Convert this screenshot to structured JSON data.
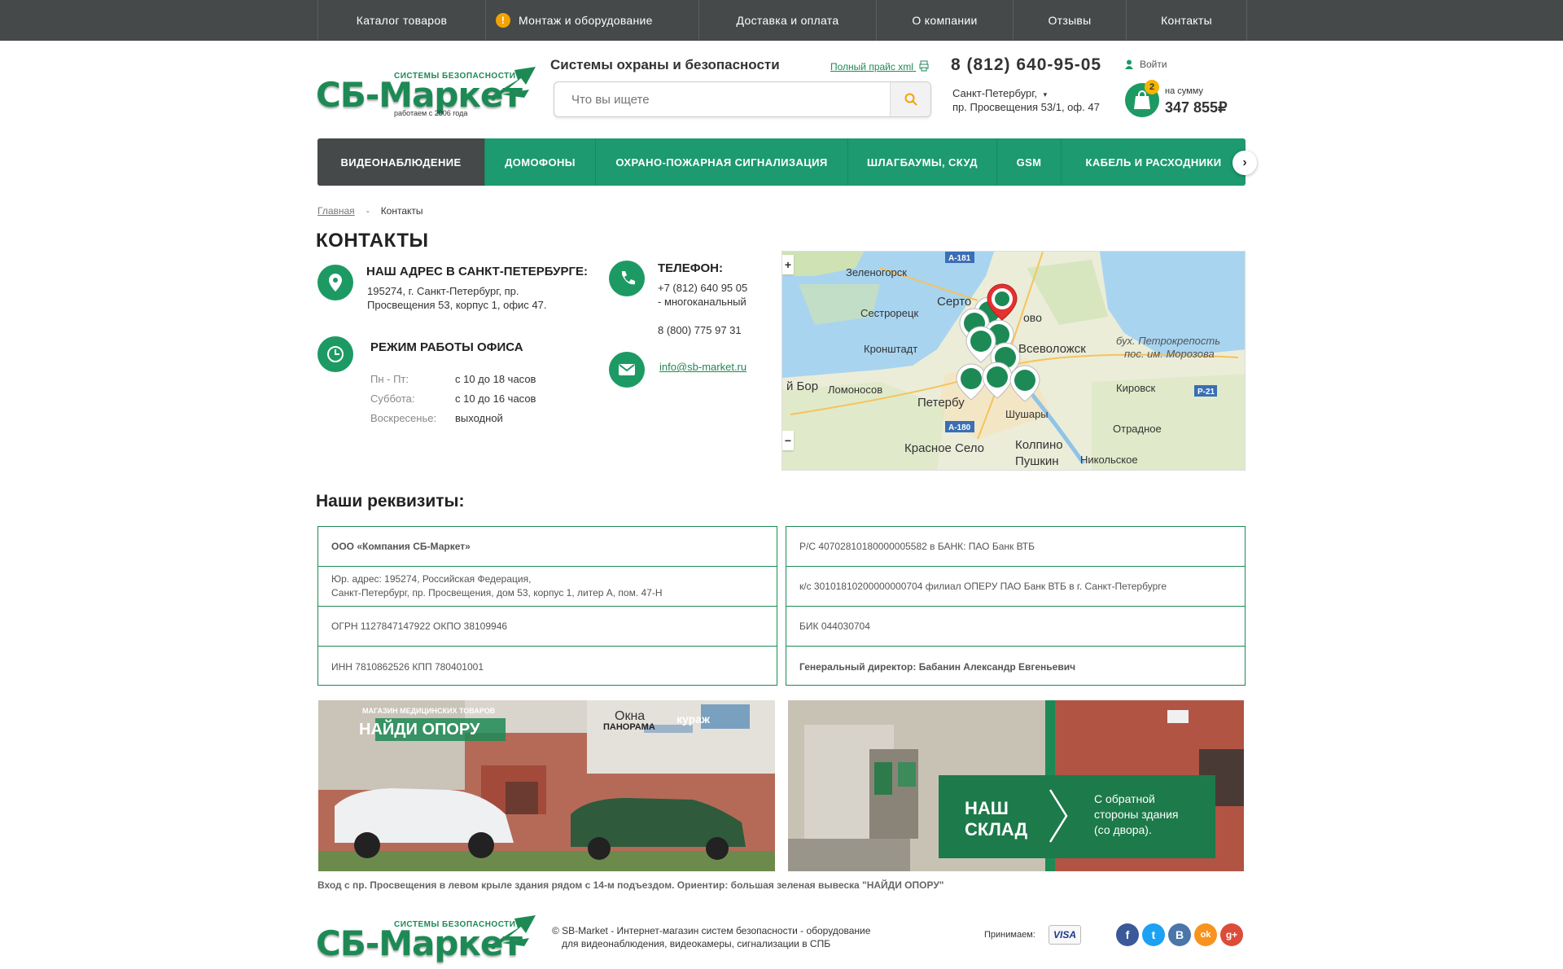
{
  "topnav": {
    "items": [
      "Каталог товаров",
      "Монтаж и оборудование",
      "Доставка и оплата",
      "О компании",
      "Отзывы",
      "Контакты"
    ],
    "warn_symbol": "!"
  },
  "header": {
    "logo_top": "СИСТЕМЫ БЕЗОПАСНОСТИ",
    "logo_text": "СБ-Маркет",
    "logo_sub": "работаем с 2006 года",
    "tagline": "Системы охраны и безопасности",
    "price_link": "Полный прайс xml",
    "search_placeholder": "Что вы ищете",
    "phone": "8 (812) 640-95-05",
    "city": "Санкт-Петербург,",
    "address": "пр. Просвещения 53/1, оф. 47",
    "login": "Войти",
    "cart_count": "2",
    "cart_label": "на сумму",
    "cart_sum": "347 855₽"
  },
  "catnav": {
    "items": [
      "ВИДЕОНАБЛЮДЕНИЕ",
      "ДОМОФОНЫ",
      "ОХРАНО-ПОЖАРНАЯ СИГНАЛИЗАЦИЯ",
      "ШЛАГБАУМЫ, СКУД",
      "GSM",
      "КАБЕЛЬ И РАСХОДНИКИ"
    ],
    "next": "›"
  },
  "breadcrumb": {
    "home": "Главная",
    "sep": "-",
    "current": "Контакты"
  },
  "page_title": "КОНТАКТЫ",
  "contacts": {
    "address_title": "НАШ АДРЕС В САНКТ-ПЕТЕРБУРГЕ:",
    "address_line1": "195274, г. Санкт-Петербург, пр.",
    "address_line2": "Просвещения 53, корпус 1, офис 47.",
    "hours_title": "РЕЖИМ РАБОТЫ ОФИСА",
    "hours": [
      {
        "label": "Пн - Пт:",
        "value": "с 10 до 18 часов"
      },
      {
        "label": "Суббота:",
        "value": "с 10 до 16 часов"
      },
      {
        "label": "Воскресенье:",
        "value": "выходной"
      }
    ],
    "phone_title": "ТЕЛЕФОН:",
    "phone1": "+7 (812) 640 95 05",
    "phone1_note": "- многоканальный",
    "phone2": "8 (800) 775 97 31",
    "email": "info@sb-market.ru"
  },
  "map": {
    "labels": [
      "Зеленогорск",
      "Сестрорецк",
      "Серто",
      "ово",
      "Кронштадт",
      "Всеволожск",
      "бух. Петрокрепость",
      "пос. им. Морозова",
      "й Бор",
      "Ломоносов",
      "Петербу",
      "Шушары",
      "Кировск",
      "Отрадное",
      "Красное Село",
      "Колпино",
      "Пушкин",
      "Никольское"
    ],
    "road_labels": [
      "А-181",
      "А-180",
      "Р-21"
    ],
    "zoom_in": "+",
    "zoom_out": "−"
  },
  "requisites": {
    "title": "Наши реквизиты:",
    "left": [
      "ООО «Компания СБ-Маркет»",
      "Юр. адрес: 195274, Российская Федерация,",
      "Санкт-Петербург, пр. Просвещения, дом 53, корпус 1, литер А, пом. 47-Н",
      "ОГРН 1127847147922 ОКПО 38109946",
      "ИНН 7810862526 КПП 780401001"
    ],
    "right": [
      "Р/С 40702810180000005582 в БАНК: ПАО Банк ВТБ",
      "к/с 30101810200000000704 филиал ОПЕРУ ПАО Банк ВТБ в г. Санкт-Петербурге",
      "БИК 044030704",
      "Генеральный директор: Бабанин Александр Евгеньевич"
    ]
  },
  "photos": {
    "sign1": "МАГАЗИН МЕДИЦИНСКИХ ТОВАРОВ",
    "sign2": "НАЙДИ ОПОРУ",
    "sign3": "Окна",
    "sign4": "ПАНОРАМА",
    "sign5": "кураж",
    "warehouse_title1": "НАШ",
    "warehouse_title2": "СКЛАД",
    "warehouse_note": "С обратной стороны здания (со двора).",
    "caption": "Вход с пр. Просвещения в левом крыле здания рядом с 14-м подъездом. Ориентир: большая зеленая вывеска \"НАЙДИ ОПОРУ\""
  },
  "footer": {
    "copyright1": "© SB-Market - Интернет-магазин систем безопасности - оборудование",
    "copyright2": "для видеонаблюдения, видеокамеры, сигнализации в СПБ",
    "accept": "Принимаем:",
    "visa": "VISA",
    "social": [
      "f",
      "t",
      "В",
      "ok",
      "g+"
    ]
  },
  "colors": {
    "brand": "#1d9a6f",
    "dark": "#45494a",
    "accent": "#f2a300"
  }
}
